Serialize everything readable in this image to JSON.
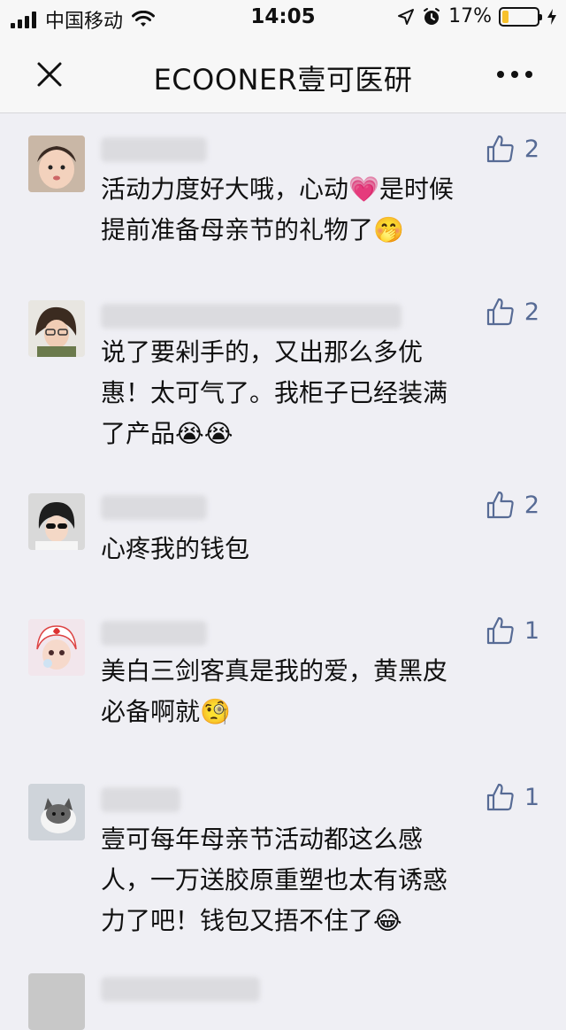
{
  "status": {
    "carrier": "中国移动",
    "time": "14:05",
    "battery": "17%"
  },
  "nav": {
    "title": "ECOONER壹可医研"
  },
  "comments": [
    {
      "likes": "2",
      "text": "活动力度好大哦，心动💗是时候\n提前准备母亲节的礼物了🤭"
    },
    {
      "likes": "2",
      "text": "说了要剁手的，又出那么多优\n惠！太可气了。我柜子已经装满\n了产品😭😭"
    },
    {
      "likes": "2",
      "text": "心疼我的钱包"
    },
    {
      "likes": "1",
      "text": "美白三剑客真是我的爱，黄黑皮\n必备啊就🧐"
    },
    {
      "likes": "1",
      "text": "壹可每年母亲节活动都这么感\n人，一万送胶原重塑也太有诱惑\n力了吧！钱包又捂不住了😂"
    }
  ],
  "colors": {
    "like": "#576b95",
    "background": "#efeff4",
    "battery": "#f7c12c"
  }
}
